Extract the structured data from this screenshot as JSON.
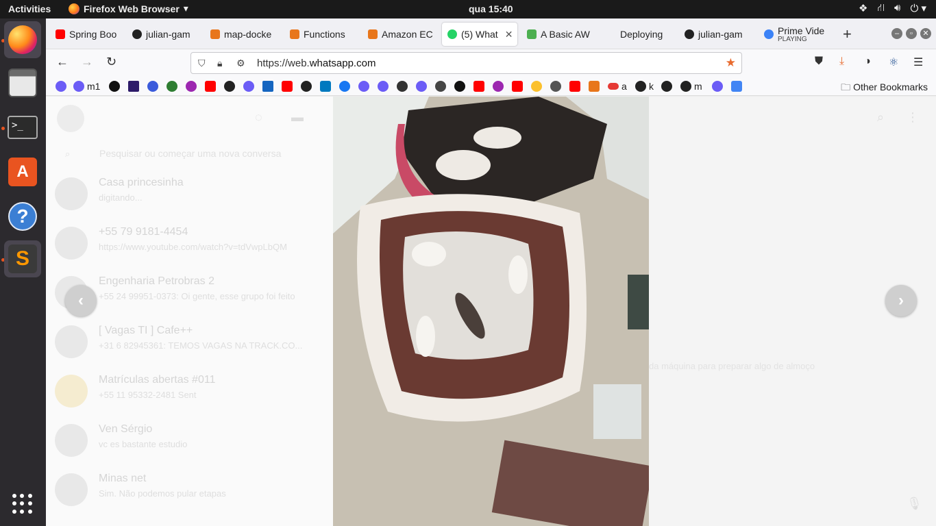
{
  "topbar": {
    "activities": "Activities",
    "app_name": "Firefox Web Browser",
    "clock": "qua 15:40"
  },
  "tabs": [
    {
      "label": "Spring Boo",
      "fav_color": "#ff0000"
    },
    {
      "label": "julian-gam",
      "fav_color": "#222222"
    },
    {
      "label": "map-docke",
      "fav_color": "#e8761b"
    },
    {
      "label": "Functions",
      "fav_color": "#e8761b"
    },
    {
      "label": "Amazon EC",
      "fav_color": "#e8761b"
    },
    {
      "label": "(5) What",
      "fav_color": "#25d366",
      "active": true
    },
    {
      "label": "A Basic AW",
      "fav_color": "#4caf50"
    },
    {
      "label": "Deploying",
      "fav_color": "#f0f0f4"
    },
    {
      "label": "julian-gam",
      "fav_color": "#222222"
    },
    {
      "label": "Prime Vide",
      "sublabel": "PLAYING",
      "fav_color": "#3b82f6"
    }
  ],
  "navbar": {
    "url_prefix": "https://web.",
    "url_domain": "whatsapp.com"
  },
  "bookmarks": {
    "labels": [
      "m1",
      "a",
      "k",
      "m"
    ],
    "other": "Other Bookmarks"
  },
  "whatsapp": {
    "search_placeholder": "Pesquisar ou começar uma nova conversa",
    "chats": [
      {
        "name": "Casa princesinha",
        "msg": "digitando..."
      },
      {
        "name": "+55 79 9181-4454",
        "msg": "https://www.youtube.com/watch?v=tdVwpLbQM"
      },
      {
        "name": "Engenharia Petrobras 2",
        "msg": "+55 24 99951-0373: Oi gente, esse grupo foi feito"
      },
      {
        "name": "[ Vagas TI ] Cafe++",
        "msg": "+31 6 82945361: TEMOS VAGAS NA TRACK.CO..."
      },
      {
        "name": "Matrículas abertas #011",
        "msg": "+55 11 95332-2481 Sent"
      },
      {
        "name": "Ven Sérgio",
        "msg": "vc es bastante estudio"
      },
      {
        "name": "Minas net",
        "msg": "Sim. Não podemos pular etapas"
      }
    ],
    "ghost_message": "da máquina para preparar algo de almoço"
  },
  "viewer": {
    "prev": "‹",
    "next": "›"
  },
  "colors": {
    "accent": "#e95420",
    "whatsapp": "#25d366"
  }
}
